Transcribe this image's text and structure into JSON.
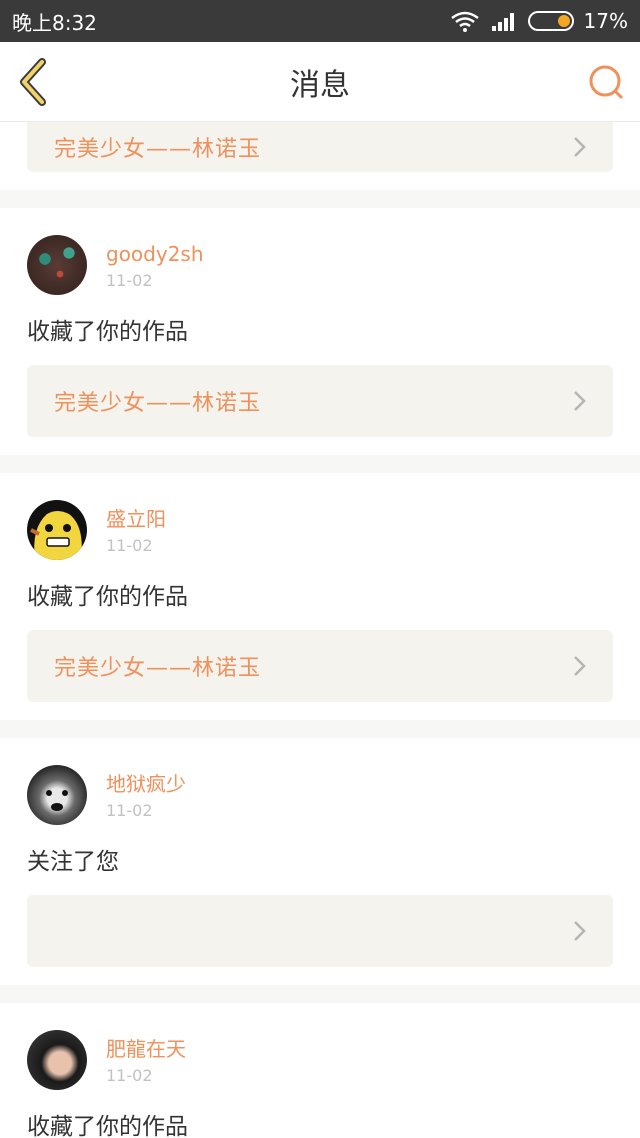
{
  "status_bar": {
    "time": "晚上8:32",
    "battery": "17%",
    "battery_level": 0.17
  },
  "header": {
    "title": "消息",
    "back_icon": "chevron-left-icon",
    "search_icon": "search-icon"
  },
  "colors": {
    "accent": "#f0905a",
    "back_icon": "#e8c34a",
    "card_bg": "#f4f3ee"
  },
  "top_partial_card": {
    "work_title": "完美少女——林诺玉"
  },
  "messages": [
    {
      "username": "goody2sh",
      "date": "11-02",
      "action": "收藏了你的作品",
      "work_title": "完美少女——林诺玉"
    },
    {
      "username": "盛立阳",
      "date": "11-02",
      "action": "收藏了你的作品",
      "work_title": "完美少女——林诺玉"
    },
    {
      "username": "地狱疯少",
      "date": "11-02",
      "action": "关注了您",
      "work_title": ""
    },
    {
      "username": "肥龍在天",
      "date": "11-02",
      "action": "收藏了你的作品"
    }
  ]
}
